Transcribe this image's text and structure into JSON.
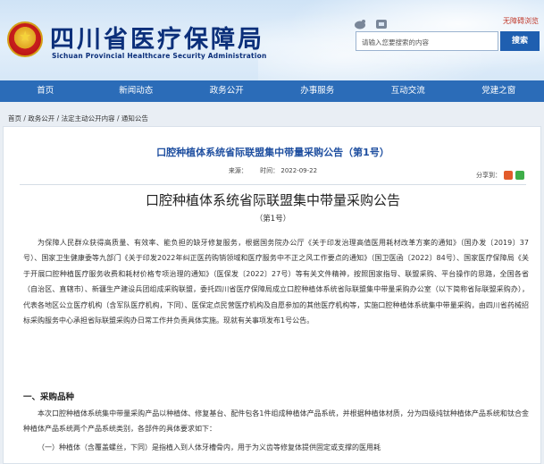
{
  "header": {
    "site_title": "四川省医疗保障局",
    "site_subtitle": "Sichuan Provincial Healthcare Security Administration",
    "accessible_link": "无障碍浏览",
    "search_placeholder": "请输入您要搜索的内容",
    "search_button": "搜索"
  },
  "nav": {
    "items": [
      "首页",
      "新闻动态",
      "政务公开",
      "办事服务",
      "互动交流",
      "党建之窗"
    ]
  },
  "breadcrumb": "首页 / 政务公开 / 法定主动公开内容 / 通知公告",
  "article": {
    "header_title": "口腔种植体系统省际联盟集中带量采购公告（第1号）",
    "source": "来源：",
    "date": "时间：  2022-09-22",
    "share_label": "分享到：",
    "main_title": "口腔种植体系统省际联盟集中带量采购公告",
    "issue_no": "（第1号）",
    "paragraph1": "为保障人民群众获得高质量、有效率、能负担的缺牙修复服务，根据国务院办公厅《关于印发治理高值医用耗材改革方案的通知》（国办发〔2019〕37号）、国家卫生健康委等九部门《关于印发2022年纠正医药购销领域和医疗服务中不正之风工作要点的通知》（国卫医函〔2022〕84号）、国家医疗保障局《关于开展口腔种植医疗服务收费和耗材价格专项治理的通知》（医保发〔2022〕27号）等有关文件精神，按照国家指导、联盟采购、平台操作的思路，全国各省（自治区、直辖市）、新疆生产建设兵团组成采购联盟，委托四川省医疗保障局成立口腔种植体系统省际联盟集中带量采购办公室（以下简称省际联盟采购办），代表各地区公立医疗机构（含军队医疗机构，下同）、医保定点民营医疗机构及自愿参加的其他医疗机构等，实施口腔种植体系统集中带量采购，由四川省药械招标采购服务中心承担省际联盟采购办日常工作并负责具体实施。现就有关事项发布1号公告。",
    "section1_heading": "一、采购品种",
    "paragraph2": "本次口腔种植体系统集中带量采购产品以种植体、修复基台、配件包各1件组成种植体产品系统，并根据种植体材质，分为四级纯钛种植体产品系统和钛合金种植体产品系统两个产品系统类别，各部件的具体要求如下：",
    "paragraph3": "（一）种植体（含覆盖螺丝，下同）是指植入到人体牙槽骨内，用于为义齿等修复体提供固定或支撑的医用耗"
  }
}
